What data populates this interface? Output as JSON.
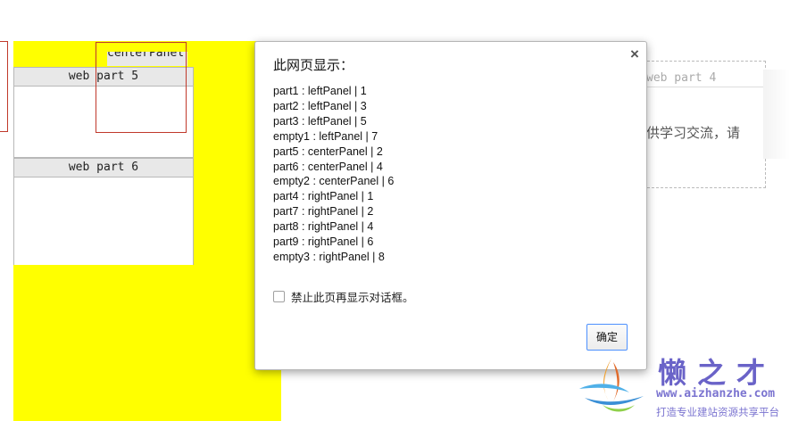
{
  "background": {
    "center_panel_label": "centerPanel",
    "web_part_5": "web part 5",
    "web_part_6": "web part 6",
    "web_part_4": "web part 4",
    "right_text": "供学习交流，请"
  },
  "dialog": {
    "title": "此网页显示：",
    "close_glyph": "×",
    "lines": [
      "part1 : leftPanel | 1",
      "part2 : leftPanel | 3",
      "part3 : leftPanel | 5",
      "empty1 : leftPanel | 7",
      "part5 : centerPanel | 2",
      "part6 : centerPanel | 4",
      "empty2 : centerPanel | 6",
      "part4 : rightPanel | 1",
      "part7 : rightPanel | 2",
      "part8 : rightPanel | 4",
      "part9 : rightPanel | 6",
      "empty3 : rightPanel | 8"
    ],
    "suppress_label": "禁止此页再显示对话框。",
    "suppress_checked": false,
    "ok_label": "确定"
  },
  "watermark": {
    "brand": "懒之才",
    "url": "www.aizhanzhe.com",
    "tagline": "打造专业建站资源共享平台"
  },
  "colors": {
    "panel_background": "#ffff00",
    "outline_red": "#c0392b",
    "button_focus": "#4d90fe",
    "watermark": "#6a63c8"
  }
}
